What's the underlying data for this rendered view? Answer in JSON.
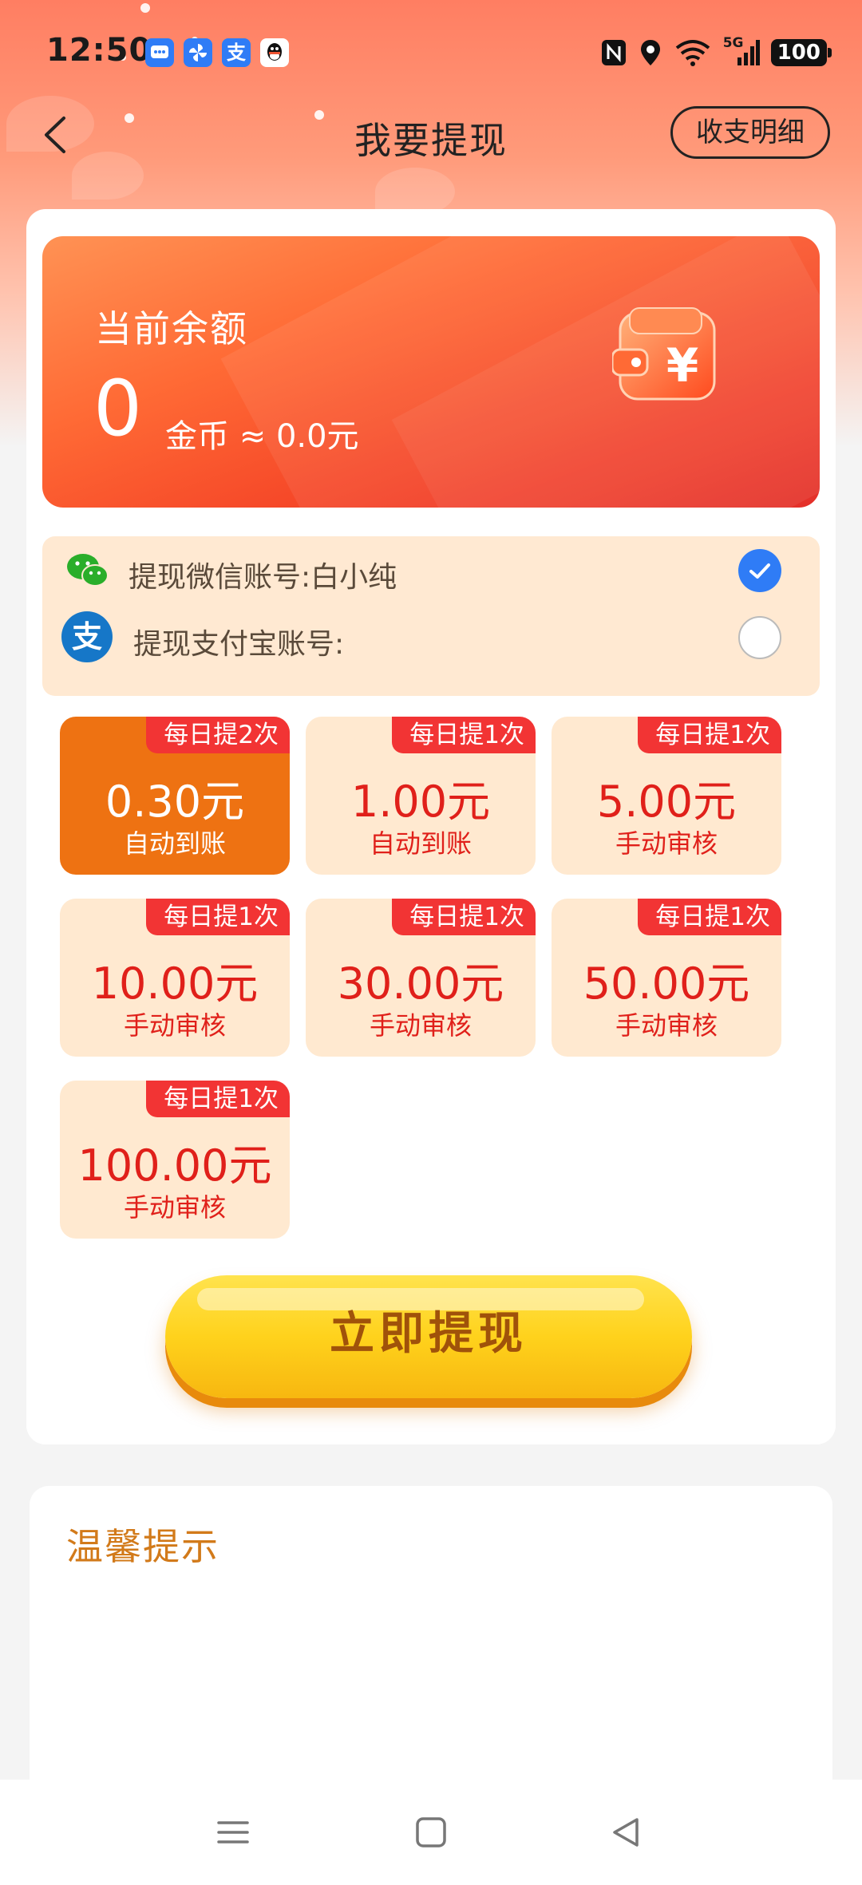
{
  "status_bar": {
    "time": "12:50",
    "app_icons": [
      "message-app-icon",
      "pinwheel-app-icon",
      "alipay-app-icon",
      "qq-app-icon"
    ],
    "alipay_glyph": "支",
    "network": "5G",
    "battery": "100"
  },
  "header": {
    "title": "我要提现",
    "detail_button": "收支明细"
  },
  "balance": {
    "label": "当前余额",
    "amount": "0",
    "unit_text": "金币 ≈ 0.0元"
  },
  "accounts": [
    {
      "label": "提现微信账号:白小纯",
      "icon": "wechat-icon",
      "checked": true
    },
    {
      "label": "提现支付宝账号:",
      "icon": "alipay-icon",
      "checked": false
    }
  ],
  "alipay_glyph": "支",
  "options": [
    {
      "badge": "每日提2次",
      "amount": "0.30元",
      "mode": "自动到账",
      "selected": true
    },
    {
      "badge": "每日提1次",
      "amount": "1.00元",
      "mode": "自动到账",
      "selected": false
    },
    {
      "badge": "每日提1次",
      "amount": "5.00元",
      "mode": "手动审核",
      "selected": false
    },
    {
      "badge": "每日提1次",
      "amount": "10.00元",
      "mode": "手动审核",
      "selected": false
    },
    {
      "badge": "每日提1次",
      "amount": "30.00元",
      "mode": "手动审核",
      "selected": false
    },
    {
      "badge": "每日提1次",
      "amount": "50.00元",
      "mode": "手动审核",
      "selected": false
    },
    {
      "badge": "每日提1次",
      "amount": "100.00元",
      "mode": "手动审核",
      "selected": false
    }
  ],
  "withdraw_button": "立即提现",
  "tips": {
    "title": "温馨提示"
  },
  "colors": {
    "accent_orange": "#ee7212",
    "badge_red": "#f23434",
    "amount_red": "#e0201a",
    "check_blue": "#2f7cf6",
    "button_yellow": "#ffd21c"
  }
}
